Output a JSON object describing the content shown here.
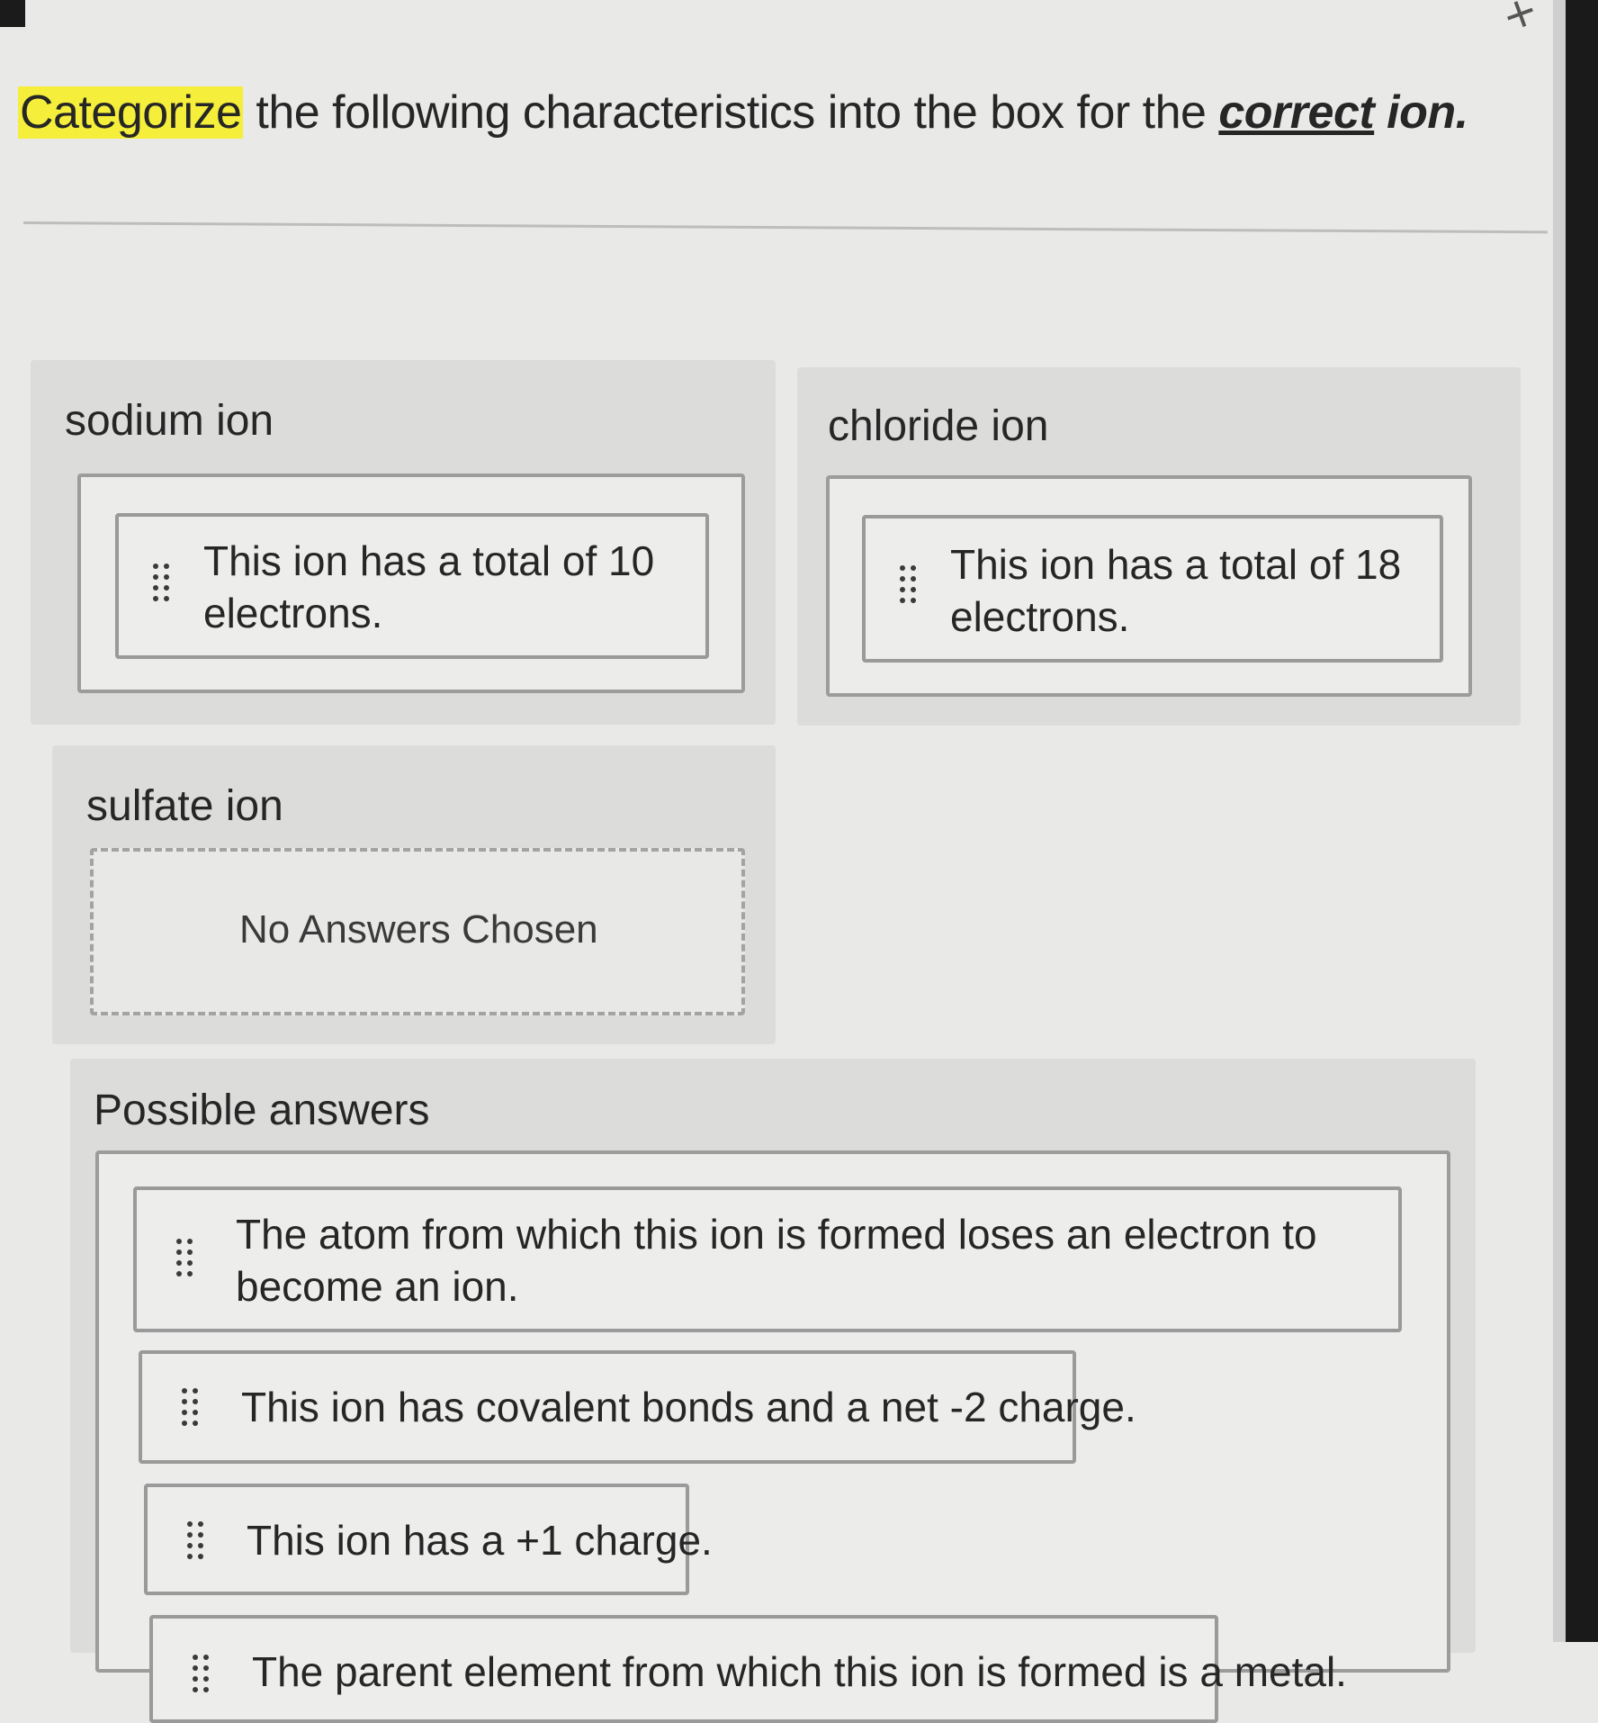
{
  "instruction": {
    "prefix": "Categorize",
    "middle": " the following characteristics into the box for the ",
    "emphasis": "correct",
    "suffix_word": " ion."
  },
  "categories": {
    "sodium": {
      "title": "sodium ion",
      "card": "This ion has a total of 10 electrons."
    },
    "chloride": {
      "title": "chloride ion",
      "card": "This ion has a total of 18 electrons."
    },
    "sulfate": {
      "title": "sulfate ion",
      "empty": "No Answers Chosen"
    }
  },
  "possible": {
    "title": "Possible answers",
    "items": [
      "The atom from which this ion is formed loses an electron to become an ion.",
      "This ion has covalent bonds and a net -2 charge.",
      "This ion has a +1 charge.",
      "The parent element from which this ion is formed is a metal."
    ]
  }
}
